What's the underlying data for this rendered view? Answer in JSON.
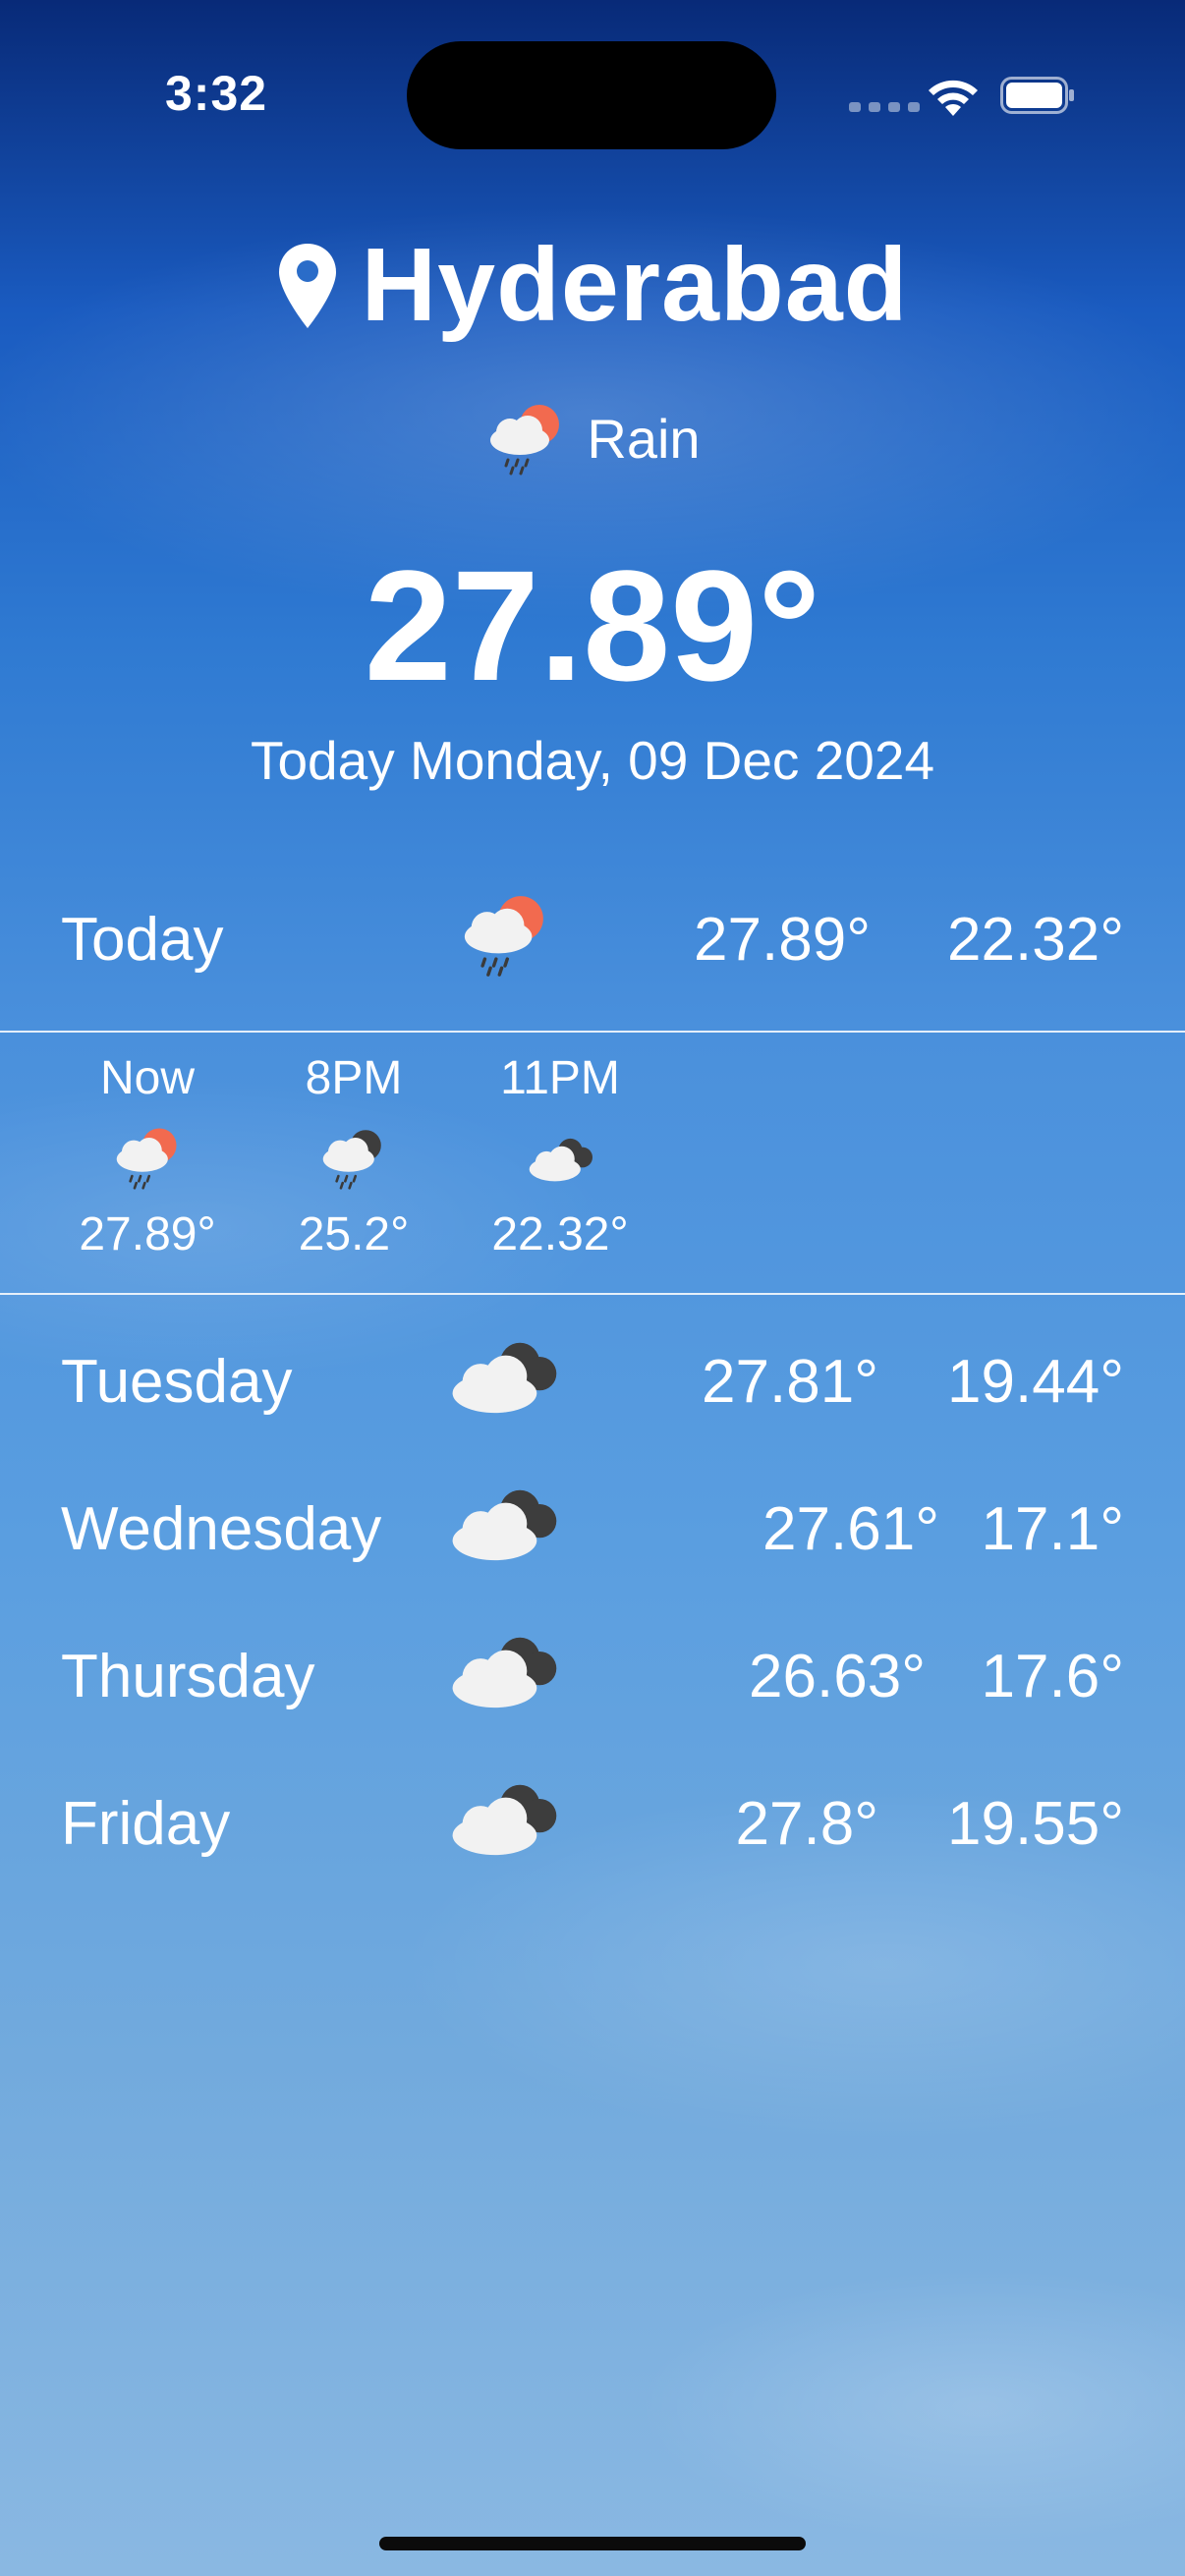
{
  "status_bar": {
    "time": "3:32"
  },
  "header": {
    "city": "Hyderabad",
    "condition": "Rain",
    "temperature": "27.89°",
    "date": "Today Monday, 09 Dec 2024"
  },
  "today": {
    "label": "Today",
    "icon": "rain-sun-icon",
    "high": "27.89°",
    "low": "22.32°"
  },
  "hourly": [
    {
      "label": "Now",
      "icon": "rain-sun-icon",
      "temp": "27.89°"
    },
    {
      "label": "8PM",
      "icon": "rain-cloud-icon",
      "temp": "25.2°"
    },
    {
      "label": "11PM",
      "icon": "cloudy-icon",
      "temp": "22.32°"
    }
  ],
  "forecast": [
    {
      "day": "Tuesday",
      "icon": "cloudy-icon",
      "high": "27.81°",
      "low": "19.44°"
    },
    {
      "day": "Wednesday",
      "icon": "cloudy-icon",
      "high": "27.61°",
      "low": "17.1°"
    },
    {
      "day": "Thursday",
      "icon": "cloudy-icon",
      "high": "26.63°",
      "low": "17.6°"
    },
    {
      "day": "Friday",
      "icon": "cloudy-icon",
      "high": "27.8°",
      "low": "19.55°"
    }
  ],
  "colors": {
    "sun": "#f26a4f",
    "cloud_light": "#f2f2f2",
    "cloud_dark": "#3d3d3d",
    "sky_top": "#082a78",
    "sky_bottom": "#8ab8e2"
  }
}
